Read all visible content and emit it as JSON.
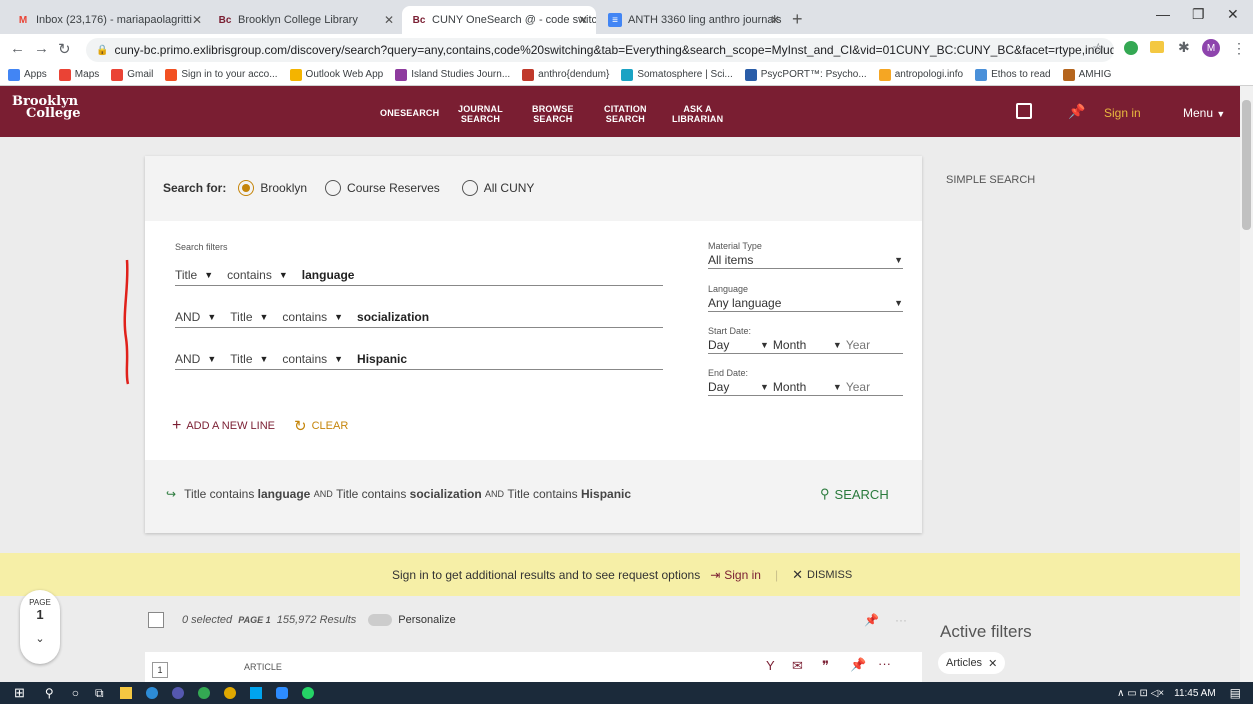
{
  "browser": {
    "tabs": [
      {
        "label": "Inbox (23,176) - mariapaolagritti",
        "icon": "gmail-icon",
        "active": false
      },
      {
        "label": "Brooklyn College Library",
        "icon": "bc-icon",
        "active": false
      },
      {
        "label": "CUNY OneSearch @ - code switc",
        "icon": "bc-icon",
        "active": true
      },
      {
        "label": "ANTH 3360 ling anthro journals",
        "icon": "docs-icon",
        "active": false
      }
    ],
    "url": "cuny-bc.primo.exlibrisgroup.com/discovery/search?query=any,contains,code%20switching&tab=Everything&search_scope=MyInst_and_CI&vid=01CUNY_BC:CUNY_BC&facet=rtype,include,a...",
    "profile_initial": "M",
    "bookmarks": [
      {
        "label": "Apps",
        "color": "#4285f4"
      },
      {
        "label": "Maps",
        "color": "#ea4335"
      },
      {
        "label": "Gmail",
        "color": "#ea4335"
      },
      {
        "label": "Sign in to your acco...",
        "color": "#f25022"
      },
      {
        "label": "Outlook Web App",
        "color": "#f4b400"
      },
      {
        "label": "Island Studies Journ...",
        "color": "#8e3b9e"
      },
      {
        "label": "anthro{dendum}",
        "color": "#c0392b"
      },
      {
        "label": "Somatosphere | Sci...",
        "color": "#1aa3c4"
      },
      {
        "label": "PsycPORT™: Psycho...",
        "color": "#2a5da8"
      },
      {
        "label": "antropologi.info",
        "color": "#f5a623"
      },
      {
        "label": "Ethos to read",
        "color": "#4a90d9"
      },
      {
        "label": "AMHIG",
        "color": "#b5651d"
      }
    ]
  },
  "site": {
    "logo_line1": "Brooklyn",
    "logo_line2": "College",
    "nav": [
      {
        "line1": "ONESEARCH",
        "line2": ""
      },
      {
        "line1": "JOURNAL",
        "line2": "SEARCH"
      },
      {
        "line1": "BROWSE",
        "line2": "SEARCH"
      },
      {
        "line1": "CITATION",
        "line2": "SEARCH"
      },
      {
        "line1": "ASK A",
        "line2": "LIBRARIAN"
      }
    ],
    "sign_in": "Sign in",
    "menu": "Menu"
  },
  "search": {
    "search_for_label": "Search for:",
    "scopes": [
      {
        "label": "Brooklyn",
        "selected": true
      },
      {
        "label": "Course Reserves",
        "selected": false
      },
      {
        "label": "All CUNY",
        "selected": false
      }
    ],
    "simple_search": "SIMPLE SEARCH",
    "filters_label": "Search filters",
    "lines": [
      {
        "operator": "",
        "field": "Title",
        "condition": "contains",
        "term": "language"
      },
      {
        "operator": "AND",
        "field": "Title",
        "condition": "contains",
        "term": "socialization"
      },
      {
        "operator": "AND",
        "field": "Title",
        "condition": "contains",
        "term": "Hispanic"
      }
    ],
    "add_line": "ADD A NEW LINE",
    "clear": "CLEAR",
    "material_type_label": "Material Type",
    "material_type_value": "All items",
    "language_label": "Language",
    "language_value": "Any language",
    "start_date_label": "Start Date:",
    "end_date_label": "End Date:",
    "day": "Day",
    "month": "Month",
    "year": "Year",
    "summary": {
      "f1": "Title contains",
      "t1": "language",
      "and1": "AND",
      "f2": "Title contains",
      "t2": "socialization",
      "and2": "AND",
      "f3": "Title contains",
      "t3": "Hispanic"
    },
    "search_button": "SEARCH"
  },
  "banner": {
    "text": "Sign in to get additional results and to see request options",
    "sign_in": "Sign in",
    "dismiss": "DISMISS"
  },
  "results": {
    "page_label": "PAGE",
    "page_number": "1",
    "selected": "0 selected",
    "page": "PAGE 1",
    "count": "155,972 Results",
    "personalize": "Personalize",
    "active_filters": "Active filters",
    "filter_chip": "Articles",
    "item_number": "1",
    "item_type": "ARTICLE"
  },
  "taskbar": {
    "time": "11:45 AM"
  }
}
